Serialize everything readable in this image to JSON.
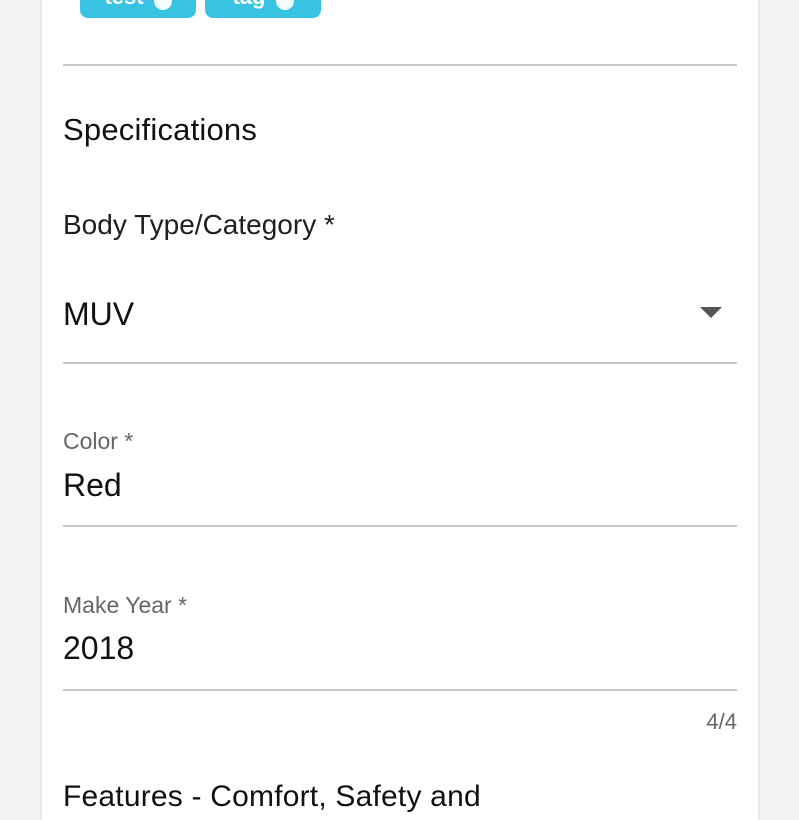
{
  "tags": [
    {
      "label": "test"
    },
    {
      "label": "tag"
    }
  ],
  "specifications": {
    "title": "Specifications",
    "body_type": {
      "label": "Body Type/Category *",
      "value": "MUV"
    },
    "color": {
      "label": "Color *",
      "value": "Red"
    },
    "make_year": {
      "label": "Make Year *",
      "value": "2018",
      "counter": "4/4"
    }
  },
  "features": {
    "title": "Features - Comfort, Safety and"
  },
  "colors": {
    "chip": "#39c3e2",
    "divider": "#c9c9c9",
    "label": "#666666"
  }
}
